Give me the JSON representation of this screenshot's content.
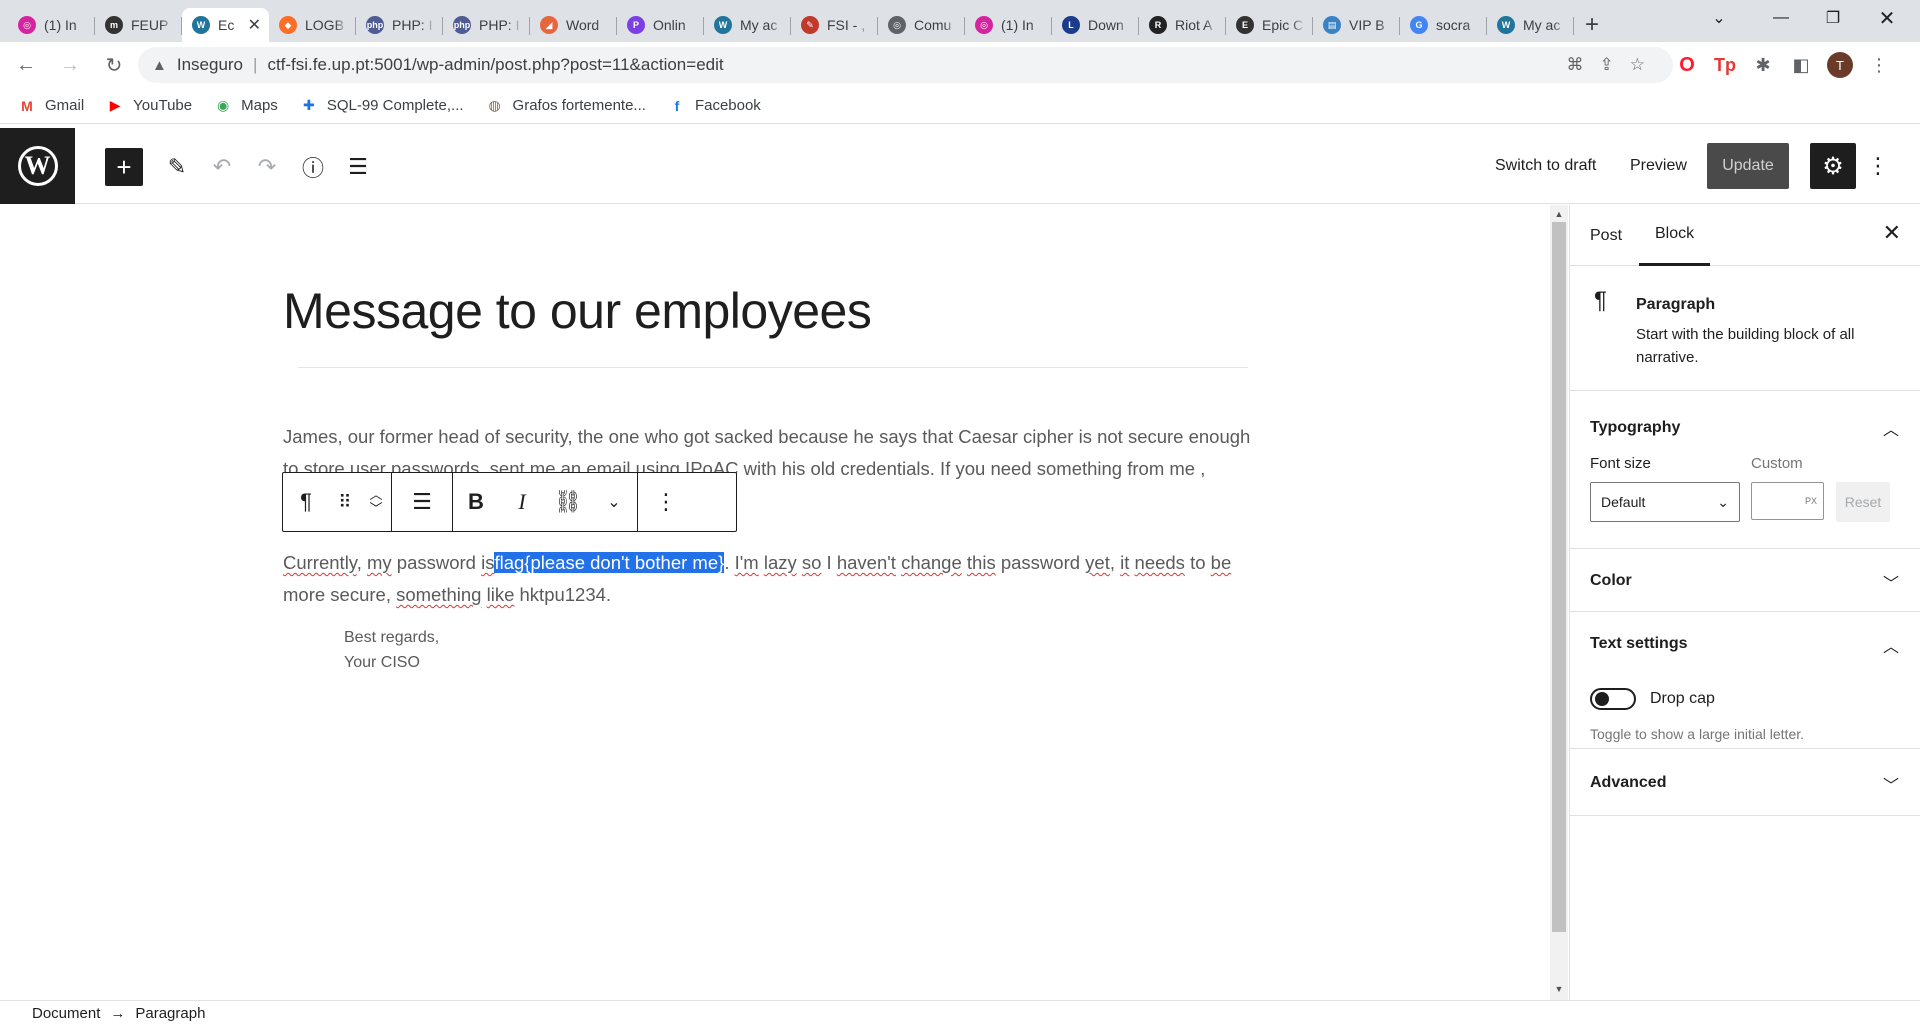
{
  "browser": {
    "tabs": [
      {
        "title": "(1) In",
        "icon": "instagram-icon",
        "color": "#d6249f",
        "glyph": "◎"
      },
      {
        "title": "FEUP",
        "icon": "feup-icon",
        "color": "#333333",
        "glyph": "m"
      },
      {
        "title": "Ec",
        "icon": "wordpress-icon",
        "color": "#21759b",
        "glyph": "W",
        "active": true
      },
      {
        "title": "LOGB",
        "icon": "gitlab-icon",
        "color": "#fc6d26",
        "glyph": "◆"
      },
      {
        "title": "PHP: I",
        "icon": "php-icon",
        "color": "#4f5b93",
        "glyph": "php"
      },
      {
        "title": "PHP: I",
        "icon": "php-icon",
        "color": "#4f5b93",
        "glyph": "php"
      },
      {
        "title": "Word",
        "icon": "wordwall-icon",
        "color": "#e8663d",
        "glyph": "◢"
      },
      {
        "title": "Onlin",
        "icon": "online-icon",
        "color": "#7b3fe4",
        "glyph": "P"
      },
      {
        "title": "My ac",
        "icon": "wordpress-icon",
        "color": "#21759b",
        "glyph": "W"
      },
      {
        "title": "FSI - ,",
        "icon": "fsi-icon",
        "color": "#c0392b",
        "glyph": "✎"
      },
      {
        "title": "Comu",
        "icon": "globe-icon",
        "color": "#5f6368",
        "glyph": "◎"
      },
      {
        "title": "(1) In",
        "icon": "instagram-icon",
        "color": "#d6249f",
        "glyph": "◎"
      },
      {
        "title": "Down",
        "icon": "download-site-icon",
        "color": "#1a3c8a",
        "glyph": "L"
      },
      {
        "title": "Riot A",
        "icon": "riot-icon",
        "color": "#222222",
        "glyph": "R"
      },
      {
        "title": "Epic C",
        "icon": "epic-icon",
        "color": "#333333",
        "glyph": "E"
      },
      {
        "title": "VIP B",
        "icon": "vip-icon",
        "color": "#3b82c4",
        "glyph": "▤"
      },
      {
        "title": "socra",
        "icon": "google-icon",
        "color": "#4285f4",
        "glyph": "G"
      },
      {
        "title": "My ac",
        "icon": "wordpress-icon",
        "color": "#21759b",
        "glyph": "W"
      }
    ],
    "address": {
      "security": "Inseguro",
      "url": "ctf-fsi.fe.up.pt:5001/wp-admin/post.php?post=11&action=edit"
    },
    "profile_initial": "T",
    "bookmarks": [
      {
        "label": "Gmail",
        "icon": "gmail-icon",
        "color": "#ea4335",
        "glyph": "M"
      },
      {
        "label": "YouTube",
        "icon": "youtube-icon",
        "color": "#ff0000",
        "glyph": "▶"
      },
      {
        "label": "Maps",
        "icon": "maps-icon",
        "color": "#34a853",
        "glyph": "◉"
      },
      {
        "label": "SQL-99 Complete,...",
        "icon": "sql-icon",
        "color": "#1a73e8",
        "glyph": "✚"
      },
      {
        "label": "Grafos fortemente...",
        "icon": "site-icon",
        "color": "#8a6d3b",
        "glyph": "◍"
      },
      {
        "label": "Facebook",
        "icon": "facebook-icon",
        "color": "#1877f2",
        "glyph": "f"
      }
    ]
  },
  "editor": {
    "header": {
      "switch_to_draft": "Switch to draft",
      "preview": "Preview",
      "update": "Update"
    },
    "post_title": "Message to our employees",
    "para1": {
      "line1": "James, our former head of security, the one who got sacked because he says that Caesar cipher is not secure enough",
      "line2": "to store user passwords,  sent me an email using IPoAC with his old credentials. If you need something from me ,"
    },
    "para2": {
      "w1": "Currently",
      "t1": ", ",
      "w2": "my",
      "t2": " password ",
      "w3": "is",
      "selected": "flag{please don't bother me}",
      "t3": ". ",
      "w4": "I'm",
      "t4": " ",
      "w5": "lazy",
      "t5": " ",
      "w6": "so",
      "t6": " I ",
      "w7": "haven't",
      "t7": " ",
      "w8": "change",
      "t8": " ",
      "w9": "this",
      "t9": " password ",
      "w10": "yet",
      "t10": ", ",
      "w11": "it",
      "t11": " ",
      "w12": "needs",
      "t12": " to ",
      "w13": "be",
      "line2a": "more secure, ",
      "w14": "something",
      "t14": " ",
      "w15": "like",
      "t15": " hktpu1234."
    },
    "signature": {
      "line1": "Best regards,",
      "line2": "Your CISO"
    }
  },
  "sidebar": {
    "tabs": {
      "post": "Post",
      "block": "Block"
    },
    "block_card": {
      "name": "Paragraph",
      "description": "Start with the building block of all narrative."
    },
    "typography": {
      "title": "Typography",
      "font_size_label": "Font size",
      "custom_label": "Custom",
      "font_size_value": "Default",
      "unit": "PX",
      "reset": "Reset"
    },
    "color": {
      "title": "Color"
    },
    "text_settings": {
      "title": "Text settings",
      "drop_cap": "Drop cap",
      "drop_cap_help": "Toggle to show a large initial letter.",
      "drop_cap_enabled": false
    },
    "advanced": {
      "title": "Advanced"
    }
  },
  "footer": {
    "crumb1": "Document",
    "arrow": "→",
    "crumb2": "Paragraph"
  }
}
